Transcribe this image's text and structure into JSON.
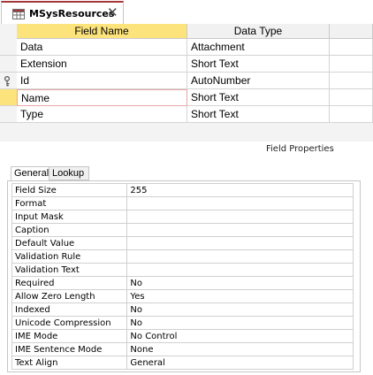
{
  "tab": {
    "title": "MSysResources",
    "close_glyph": "✕"
  },
  "grid": {
    "headers": {
      "field_name": "Field Name",
      "data_type": "Data Type"
    },
    "rows": [
      {
        "name": "Data",
        "type": "Attachment",
        "primary_key": false,
        "current": false
      },
      {
        "name": "Extension",
        "type": "Short Text",
        "primary_key": false,
        "current": false
      },
      {
        "name": "Id",
        "type": "AutoNumber",
        "primary_key": true,
        "current": false
      },
      {
        "name": "Name",
        "type": "Short Text",
        "primary_key": false,
        "current": true
      },
      {
        "name": "Type",
        "type": "Short Text",
        "primary_key": false,
        "current": false
      }
    ]
  },
  "field_properties": {
    "caption": "Field Properties",
    "tabs": {
      "general": "General",
      "lookup": "Lookup"
    },
    "properties": [
      {
        "name": "Field Size",
        "value": "255"
      },
      {
        "name": "Format",
        "value": ""
      },
      {
        "name": "Input Mask",
        "value": ""
      },
      {
        "name": "Caption",
        "value": ""
      },
      {
        "name": "Default Value",
        "value": ""
      },
      {
        "name": "Validation Rule",
        "value": ""
      },
      {
        "name": "Validation Text",
        "value": ""
      },
      {
        "name": "Required",
        "value": "No"
      },
      {
        "name": "Allow Zero Length",
        "value": "Yes"
      },
      {
        "name": "Indexed",
        "value": "No"
      },
      {
        "name": "Unicode Compression",
        "value": "No"
      },
      {
        "name": "IME Mode",
        "value": "No Control"
      },
      {
        "name": "IME Sentence Mode",
        "value": "None"
      },
      {
        "name": "Text Align",
        "value": "General"
      }
    ]
  },
  "colors": {
    "header_highlight": "#fce37b",
    "tab_accent": "#a4373a",
    "active_cell_border": "#e6a7a7"
  }
}
